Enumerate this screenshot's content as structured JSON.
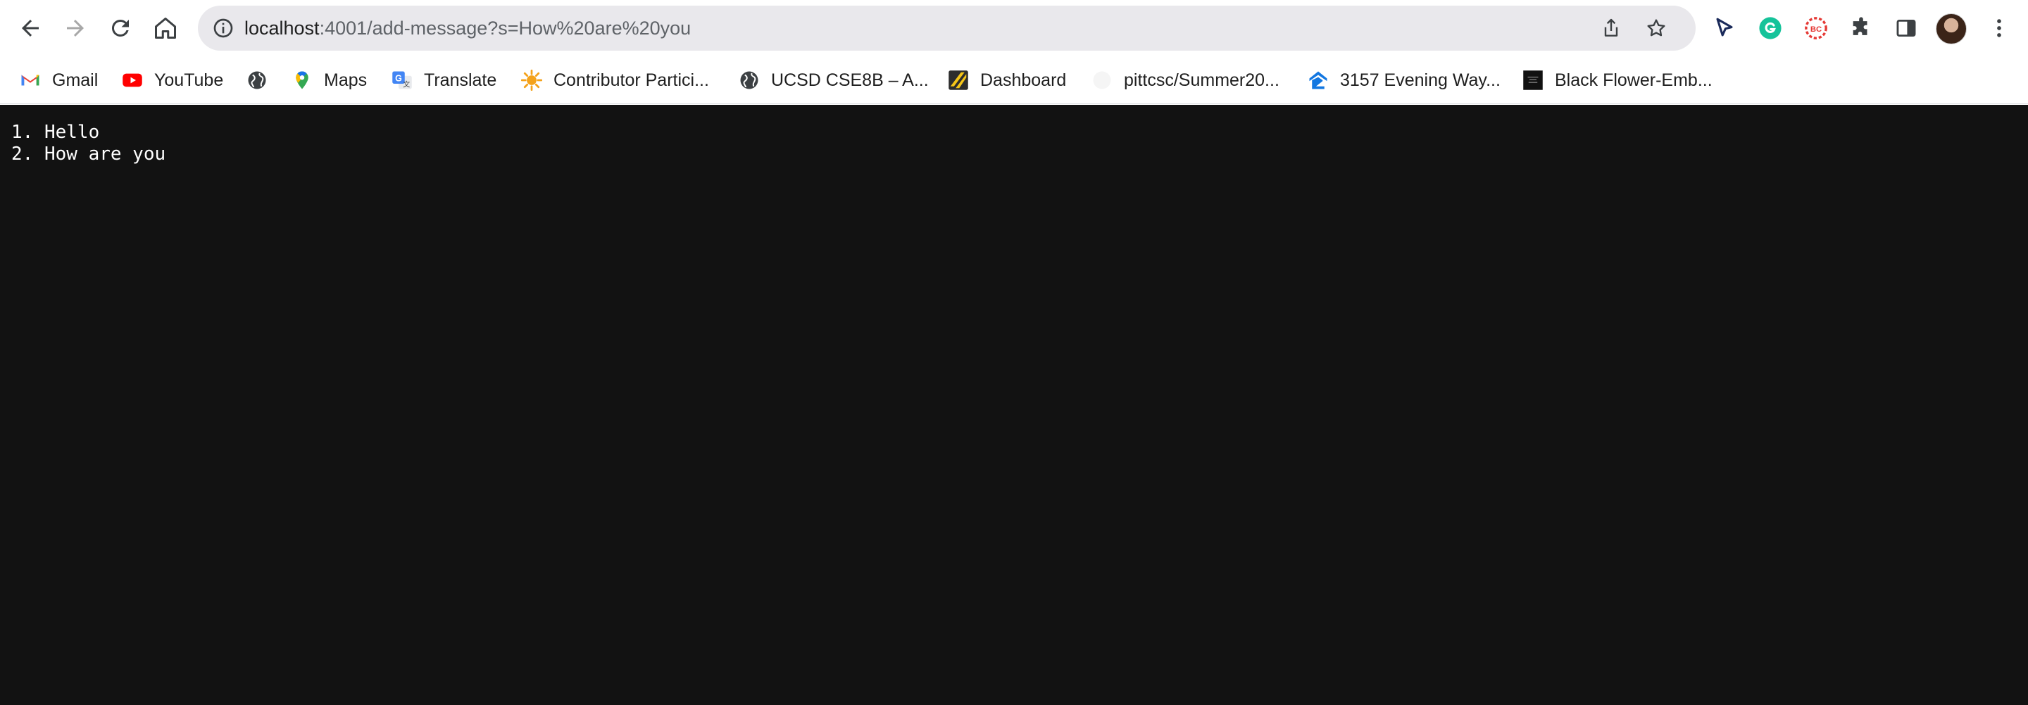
{
  "browser": {
    "url_host": "localhost",
    "url_path": ":4001/add-message?s=How%20are%20you"
  },
  "bookmarks": [
    {
      "label": "Gmail",
      "icon": "gmail-icon"
    },
    {
      "label": "YouTube",
      "icon": "youtube-icon"
    },
    {
      "label": "",
      "icon": "globe-icon"
    },
    {
      "label": "Maps",
      "icon": "maps-icon"
    },
    {
      "label": "Translate",
      "icon": "translate-icon"
    },
    {
      "label": "Contributor Partici...",
      "icon": "sun-icon"
    },
    {
      "label": "UCSD CSE8B – A...",
      "icon": "globe-icon"
    },
    {
      "label": "Dashboard",
      "icon": "dashboard-icon"
    },
    {
      "label": "pittcsc/Summer20...",
      "icon": "github-icon"
    },
    {
      "label": "3157 Evening Way...",
      "icon": "zillow-icon"
    },
    {
      "label": "Black Flower-Emb...",
      "icon": "store-icon"
    }
  ],
  "page": {
    "messages": [
      "1. Hello",
      "2. How are you"
    ]
  },
  "colors": {
    "page_background": "#121212",
    "text": "#ffffff"
  }
}
